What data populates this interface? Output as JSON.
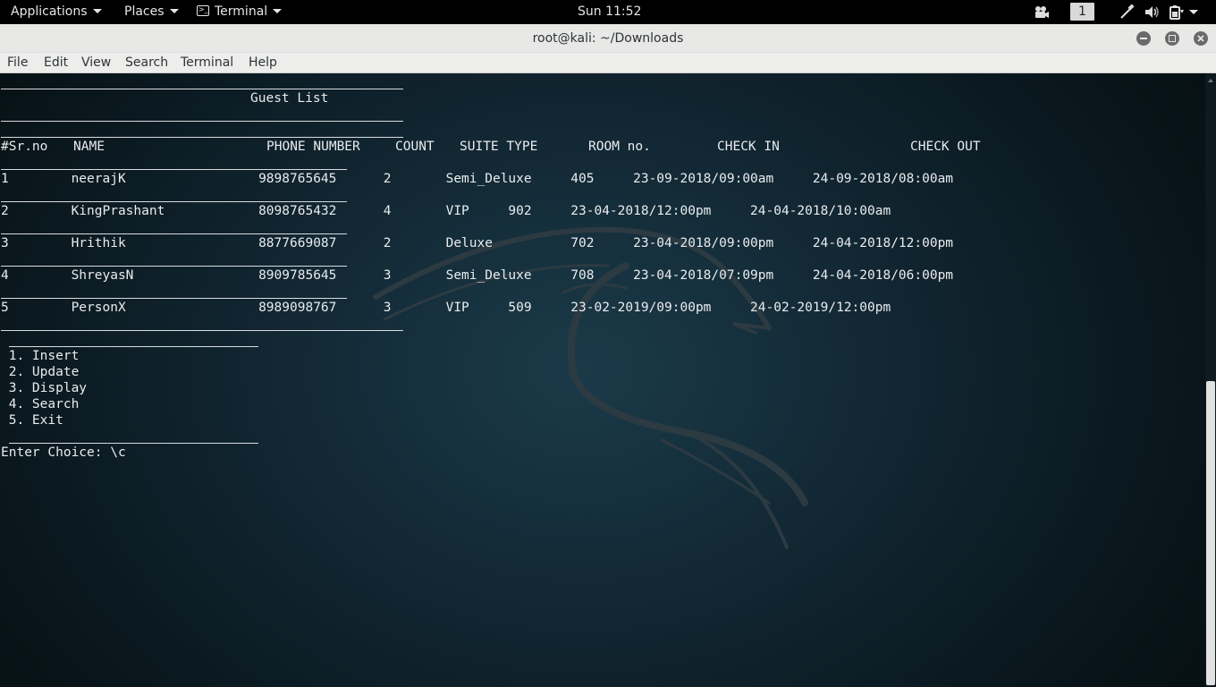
{
  "topbar": {
    "applications": "Applications",
    "places": "Places",
    "terminal": "Terminal",
    "clock": "Sun 11:52",
    "workspace": "1"
  },
  "window": {
    "title": "root@kali: ~/Downloads"
  },
  "menubar": [
    "File",
    "Edit",
    "View",
    "Search",
    "Terminal",
    "Help"
  ],
  "terminal": {
    "heading": "Guest List",
    "columns": {
      "sr": "#Sr.no",
      "name": "NAME",
      "phone": "PHONE NUMBER",
      "count": "COUNT",
      "suite": "SUITE TYPE",
      "room": "ROOM no.",
      "checkin": "CHECK IN",
      "checkout": "CHECK OUT"
    },
    "rows": [
      {
        "text": "1        neerajK                 9898765645      2       Semi_Deluxe     405     23-09-2018/09:00am     24-09-2018/08:00am"
      },
      {
        "text": "2        KingPrashant            8098765432      4       VIP     902     23-04-2018/12:00pm     24-04-2018/10:00am"
      },
      {
        "text": "3        Hrithik                 8877669087      2       Deluxe          702     23-04-2018/09:00pm     24-04-2018/12:00pm"
      },
      {
        "text": "4        ShreyasN                8909785645      3       Semi_Deluxe     708     23-04-2018/07:09pm     24-04-2018/06:00pm"
      },
      {
        "text": "5        PersonX                 8989098767      3       VIP     509     23-02-2019/09:00pm     24-02-2019/12:00pm"
      }
    ],
    "menu": [
      " 1. Insert",
      " 2. Update",
      " 3. Display",
      " 4. Search",
      " 5. Exit"
    ],
    "prompt": "Enter Choice: \\c"
  },
  "colors": {
    "terminal_bg": "#0e2230",
    "terminal_fg": "#e9ecee",
    "titlebar_bg": "#e8e8e7",
    "topbar_bg": "#000000"
  }
}
